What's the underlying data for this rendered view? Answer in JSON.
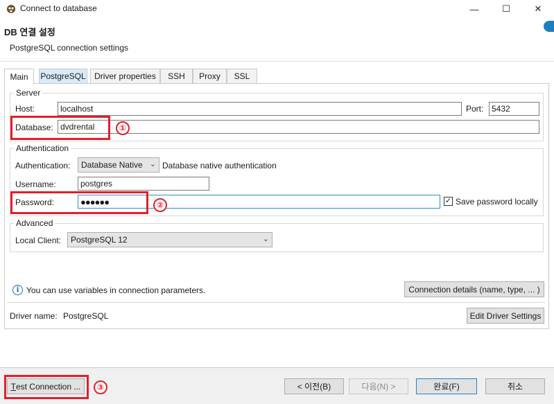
{
  "window": {
    "title": "Connect to database",
    "icon": "dbeaver-icon",
    "minimize_glyph": "—",
    "maximize_glyph": "☐",
    "close_glyph": "✕"
  },
  "header": {
    "title": "DB 연결 설정",
    "subtitle": "PostgreSQL connection settings"
  },
  "tabs": [
    {
      "label": "Main",
      "active": true
    },
    {
      "label": "PostgreSQL",
      "active": false
    },
    {
      "label": "Driver properties",
      "active": false
    },
    {
      "label": "SSH",
      "active": false
    },
    {
      "label": "Proxy",
      "active": false
    },
    {
      "label": "SSL",
      "active": false
    }
  ],
  "server": {
    "group_label": "Server",
    "host_label": "Host:",
    "host_value": "localhost",
    "port_label": "Port:",
    "port_value": "5432",
    "database_label": "Database:",
    "database_value": "dvdrental"
  },
  "auth": {
    "group_label": "Authentication",
    "auth_label": "Authentication:",
    "auth_value": "Database Native",
    "auth_desc": "Database native authentication",
    "username_label": "Username:",
    "username_value": "postgres",
    "password_label": "Password:",
    "password_value": "●●●●●●",
    "save_password_label": "Save password locally",
    "save_password_checked": true
  },
  "advanced": {
    "group_label": "Advanced",
    "local_client_label": "Local Client:",
    "local_client_value": "PostgreSQL 12"
  },
  "info": {
    "text": "You can use variables in connection parameters.",
    "details_button": "Connection details (name, type, ... )"
  },
  "driver": {
    "label": "Driver name:",
    "value": "PostgreSQL",
    "edit_button": "Edit Driver Settings"
  },
  "footer": {
    "test_connection": "Test Connection ...",
    "test_connection_mnemonic": "T",
    "test_connection_rest": "est Connection ...",
    "back": "< 이전(B)",
    "next": "다음(N) >",
    "finish": "완료(F)",
    "cancel": "취소"
  },
  "annotations": {
    "badge1": "①",
    "badge2": "②",
    "badge3": "③",
    "highlight_color": "#e0202a"
  },
  "colors": {
    "accent": "#1c7fc0",
    "tab_highlight": "#d9ebf7"
  }
}
